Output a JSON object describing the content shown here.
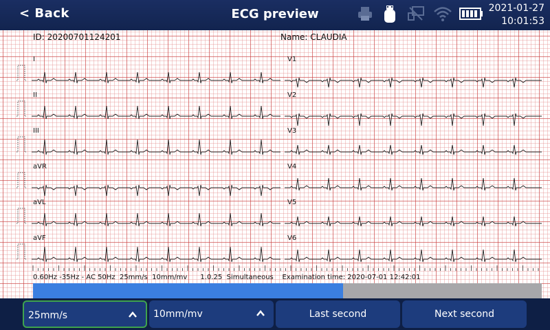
{
  "header": {
    "back_label": "< Back",
    "title": "ECG preview",
    "date": "2021-01-27",
    "time": "10:01:53",
    "icons": [
      "printer-icon",
      "usb-icon",
      "network-icon",
      "wifi-icon",
      "battery-icon"
    ]
  },
  "patient": {
    "id_label": "ID: 20200701124201",
    "name_label": "Name: CLAUDIA"
  },
  "leads": {
    "left": [
      "I",
      "II",
      "III",
      "aVR",
      "aVL",
      "aVF"
    ],
    "right": [
      "V1",
      "V2",
      "V3",
      "V4",
      "V5",
      "V6"
    ]
  },
  "footer_info": "0.60Hz -35Hz - AC 50Hz  25mm/s  10mm/mv      1.0.25  Simultaneous    Examination time: 2020-07-01 12:42:01",
  "progress": {
    "fraction": 0.61
  },
  "controls": {
    "speed": "25mm/s",
    "gain": "10mm/mv",
    "last_second": "Last second",
    "next_second": "Next second"
  },
  "colors": {
    "accent_blue": "#3b7fe0",
    "active_border": "#3fa34d",
    "button_bg": "#1d3c7d",
    "bar_bg": "#0e1f45"
  }
}
